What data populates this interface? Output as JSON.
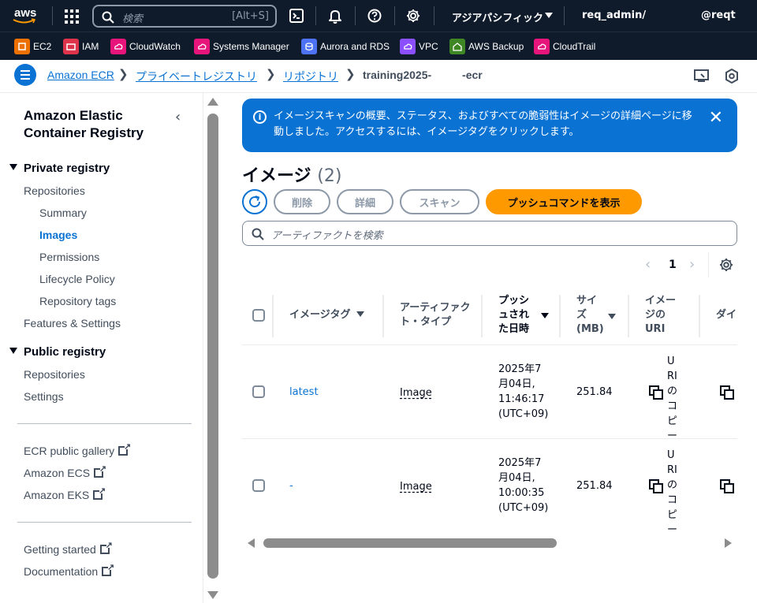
{
  "topbar": {
    "logo_text": "aws",
    "search_placeholder": "検索",
    "search_shortcut": "[Alt+S]",
    "region": "アジアパシフィック",
    "account": "req_admin/",
    "user": "@reqt"
  },
  "favorites": [
    {
      "label": "EC2",
      "color": "#ed7100"
    },
    {
      "label": "IAM",
      "color": "#dd344c"
    },
    {
      "label": "CloudWatch",
      "color": "#e7157b"
    },
    {
      "label": "Systems Manager",
      "color": "#e7157b"
    },
    {
      "label": "Aurora and RDS",
      "color": "#4d72f3"
    },
    {
      "label": "VPC",
      "color": "#8c4fff"
    },
    {
      "label": "AWS Backup",
      "color": "#3f8624"
    },
    {
      "label": "CloudTrail",
      "color": "#e7157b"
    }
  ],
  "breadcrumb": {
    "items": [
      "Amazon ECR",
      "プライベートレジストリ",
      "リポジトリ"
    ],
    "current": "training2025-          -ecr"
  },
  "sidebar": {
    "title": "Amazon Elastic Container Registry",
    "private_section": "Private registry",
    "private_items": {
      "repositories": "Repositories",
      "summary": "Summary",
      "images": "Images",
      "permissions": "Permissions",
      "lifecycle": "Lifecycle Policy",
      "repo_tags": "Repository tags",
      "features": "Features & Settings"
    },
    "public_section": "Public registry",
    "public_items": {
      "repositories": "Repositories",
      "settings": "Settings"
    },
    "links": {
      "gallery": "ECR public gallery",
      "ecs": "Amazon ECS",
      "eks": "Amazon EKS",
      "getting_started": "Getting started",
      "documentation": "Documentation"
    }
  },
  "flash": {
    "message": "イメージスキャンの概要、ステータス、およびすべての脆弱性はイメージの詳細ページに移動しました。アクセスするには、イメージタグをクリックします。"
  },
  "main": {
    "heading": "イメージ",
    "count": "(2)",
    "buttons": {
      "delete": "削除",
      "details": "詳細",
      "scan": "スキャン",
      "push": "プッシュコマンドを表示"
    },
    "filter_placeholder": "アーティファクトを検索",
    "page": "1"
  },
  "table": {
    "headers": {
      "tag": "イメージタグ",
      "artifact_type": "アーティファクト・タイプ",
      "pushed_at": "プッシュされた日時",
      "size": "サイズ (MB)",
      "uri": "イメージのURI",
      "digest": "ダイ"
    },
    "rows": [
      {
        "tag": "latest",
        "type": "Image",
        "pushed_at": "2025年7月04日, 11:46:17 (UTC+09)",
        "size": "251.84",
        "uri": "URIのコピー"
      },
      {
        "tag": "-",
        "type": "Image",
        "pushed_at": "2025年7月04日, 10:00:35 (UTC+09)",
        "size": "251.84",
        "uri": "URIのコピー"
      }
    ]
  }
}
